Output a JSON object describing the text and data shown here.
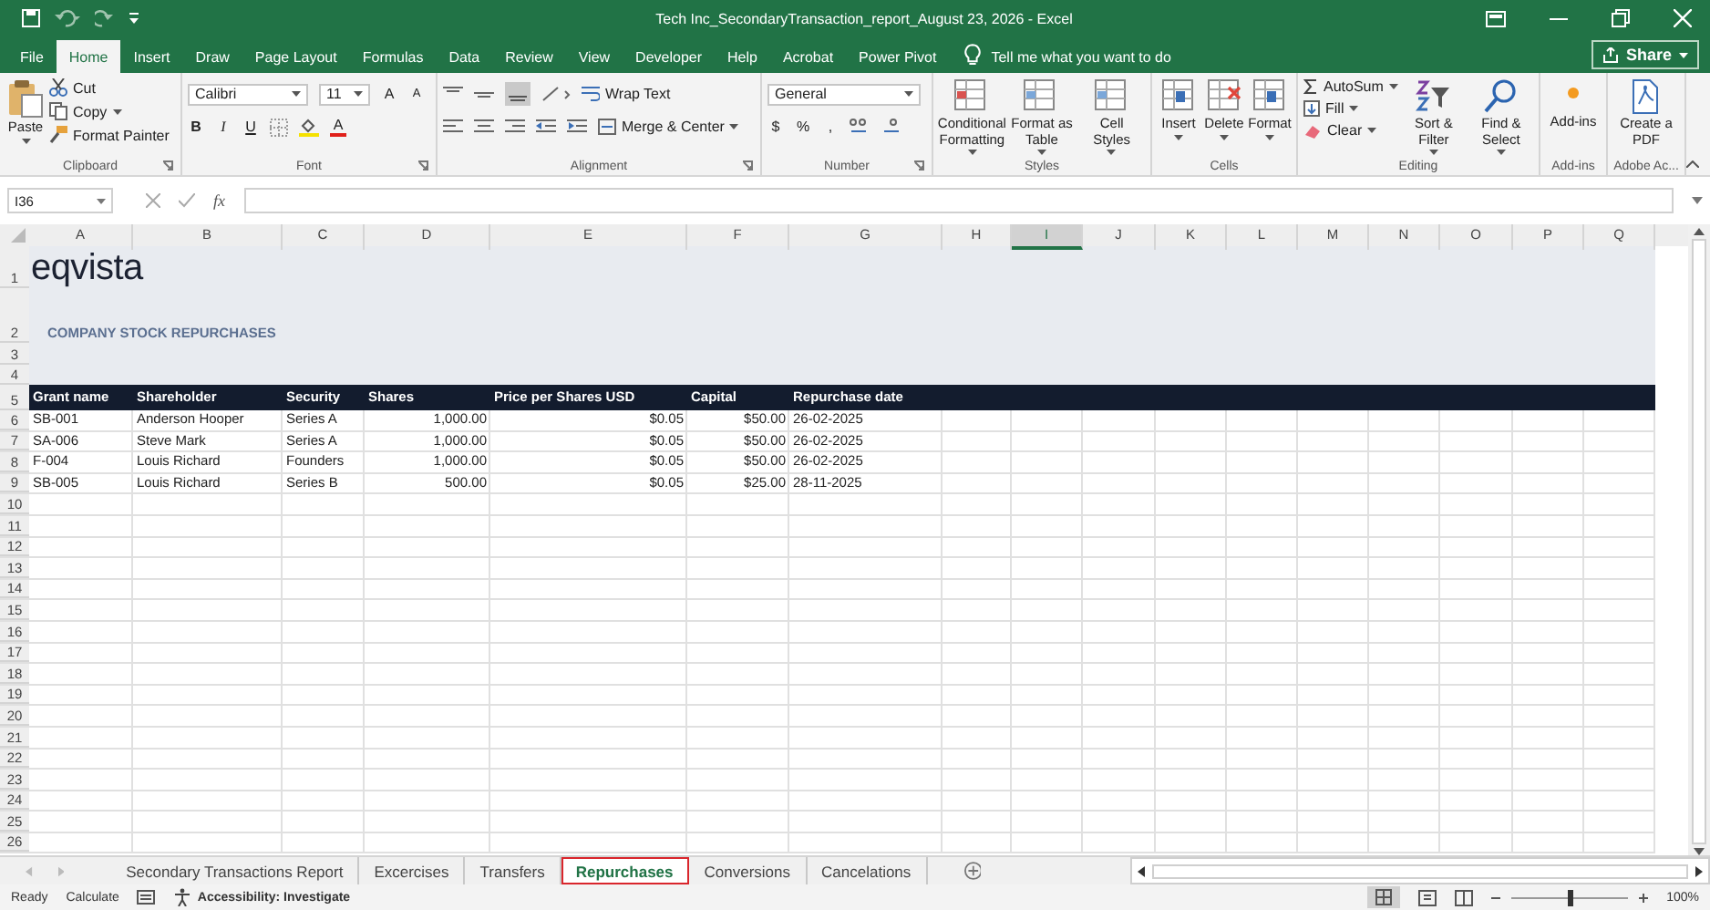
{
  "window": {
    "title": "Tech Inc_SecondaryTransaction_report_August 23, 2026  -  Excel"
  },
  "ribbon_tabs": [
    {
      "label": "File",
      "selected": false
    },
    {
      "label": "Home",
      "selected": true
    },
    {
      "label": "Insert",
      "selected": false
    },
    {
      "label": "Draw",
      "selected": false
    },
    {
      "label": "Page Layout",
      "selected": false
    },
    {
      "label": "Formulas",
      "selected": false
    },
    {
      "label": "Data",
      "selected": false
    },
    {
      "label": "Review",
      "selected": false
    },
    {
      "label": "View",
      "selected": false
    },
    {
      "label": "Developer",
      "selected": false
    },
    {
      "label": "Help",
      "selected": false
    },
    {
      "label": "Acrobat",
      "selected": false
    },
    {
      "label": "Power Pivot",
      "selected": false
    }
  ],
  "tell_me": "Tell me what you want to do",
  "share": "Share",
  "groups": [
    {
      "kind": "clipboard",
      "label": "Clipboard",
      "paste": "Paste",
      "commands": [
        "Cut",
        "Copy",
        "Format Painter"
      ]
    },
    {
      "kind": "font",
      "label": "Font",
      "font_name": "Calibri",
      "font_size": "11",
      "grow": "A",
      "shrink": "A",
      "styles": [
        "B",
        "I",
        "U"
      ],
      "font_color": "A"
    },
    {
      "kind": "alignment",
      "label": "Alignment",
      "wrap": "Wrap Text",
      "merge": "Merge & Center"
    },
    {
      "kind": "number",
      "label": "Number",
      "format": "General",
      "symbols": [
        "$",
        "%",
        ","
      ]
    },
    {
      "kind": "styles",
      "label": "Styles",
      "buttons": [
        "Conditional Formatting",
        "Format as Table",
        "Cell Styles"
      ]
    },
    {
      "kind": "cells",
      "label": "Cells",
      "buttons": [
        "Insert",
        "Delete",
        "Format"
      ]
    },
    {
      "kind": "editing",
      "label": "Editing",
      "commands": [
        "AutoSum",
        "Fill",
        "Clear"
      ],
      "buttons": [
        "Sort & Filter",
        "Find & Select"
      ]
    },
    {
      "kind": "addins",
      "label": "Add-ins",
      "button": "Add-ins"
    },
    {
      "kind": "adobe",
      "label": "Adobe Ac...",
      "button": "Create a PDF"
    }
  ],
  "name_box": "I36",
  "formula_label": "fx",
  "columns": [
    {
      "label": "A",
      "selected": false
    },
    {
      "label": "B",
      "selected": false
    },
    {
      "label": "C",
      "selected": false
    },
    {
      "label": "D",
      "selected": false
    },
    {
      "label": "E",
      "selected": false
    },
    {
      "label": "F",
      "selected": false
    },
    {
      "label": "G",
      "selected": false
    },
    {
      "label": "H",
      "selected": false
    },
    {
      "label": "I",
      "selected": true
    },
    {
      "label": "J",
      "selected": false
    },
    {
      "label": "K",
      "selected": false
    },
    {
      "label": "L",
      "selected": false
    },
    {
      "label": "M",
      "selected": false
    },
    {
      "label": "N",
      "selected": false
    },
    {
      "label": "O",
      "selected": false
    },
    {
      "label": "P",
      "selected": false
    },
    {
      "label": "Q",
      "selected": false
    }
  ],
  "rows": [
    {
      "number": "1",
      "kind": "logo",
      "text": "eqvista"
    },
    {
      "number": "2",
      "kind": "title",
      "text": "COMPANY STOCK REPURCHASES"
    },
    {
      "number": "3",
      "kind": "band"
    },
    {
      "number": "4",
      "kind": "band"
    },
    {
      "number": "5",
      "kind": "header",
      "cells": [
        "Grant name",
        "Shareholder",
        "Security",
        "Shares",
        "Price per Shares USD",
        "Capital",
        "Repurchase date"
      ]
    },
    {
      "number": "6",
      "kind": "data",
      "cells": [
        "SB-001",
        "Anderson Hooper",
        "Series A",
        "1,000.00",
        "$0.05",
        "$50.00",
        "26-02-2025"
      ]
    },
    {
      "number": "7",
      "kind": "data",
      "cells": [
        "SA-006",
        "Steve Mark",
        "Series A",
        "1,000.00",
        "$0.05",
        "$50.00",
        "26-02-2025"
      ]
    },
    {
      "number": "8",
      "kind": "data",
      "cells": [
        "F-004",
        "Louis Richard",
        "Founders",
        "1,000.00",
        "$0.05",
        "$50.00",
        "26-02-2025"
      ]
    },
    {
      "number": "9",
      "kind": "data",
      "cells": [
        "SB-005",
        "Louis Richard",
        "Series B",
        "500.00",
        "$0.05",
        "$25.00",
        "28-11-2025"
      ]
    },
    {
      "number": "10",
      "kind": "empty"
    },
    {
      "number": "11",
      "kind": "empty"
    },
    {
      "number": "12",
      "kind": "empty"
    },
    {
      "number": "13",
      "kind": "empty"
    },
    {
      "number": "14",
      "kind": "empty"
    },
    {
      "number": "15",
      "kind": "empty"
    },
    {
      "number": "16",
      "kind": "empty"
    },
    {
      "number": "17",
      "kind": "empty"
    },
    {
      "number": "18",
      "kind": "empty"
    },
    {
      "number": "19",
      "kind": "empty"
    },
    {
      "number": "20",
      "kind": "empty"
    },
    {
      "number": "21",
      "kind": "empty"
    },
    {
      "number": "22",
      "kind": "empty"
    },
    {
      "number": "23",
      "kind": "empty"
    },
    {
      "number": "24",
      "kind": "empty"
    },
    {
      "number": "25",
      "kind": "empty"
    },
    {
      "number": "26",
      "kind": "empty"
    }
  ],
  "sheet_tabs": [
    {
      "label": "Secondary Transactions Report",
      "selected": false
    },
    {
      "label": "Excercises",
      "selected": false
    },
    {
      "label": "Transfers",
      "selected": false
    },
    {
      "label": "Repurchases",
      "selected": true
    },
    {
      "label": "Conversions",
      "selected": false
    },
    {
      "label": "Cancelations",
      "selected": false
    }
  ],
  "status": {
    "ready": "Ready",
    "calculate": "Calculate",
    "accessibility": "Accessibility: Investigate",
    "zoom": "100%",
    "zoom_slider": {
      "level": 0.5
    }
  }
}
